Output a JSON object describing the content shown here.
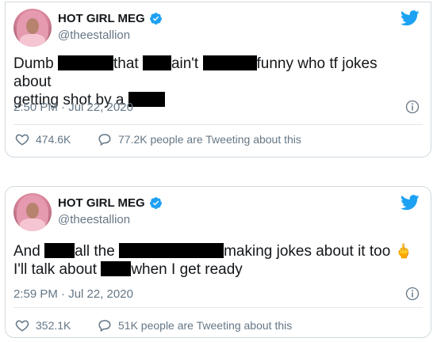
{
  "tweets": [
    {
      "name": "HOT GIRL MEG",
      "handle": "@theestallion",
      "text_parts": [
        "Dumb",
        "that",
        "ain't",
        "funny who tf jokes about",
        "getting shot by a"
      ],
      "time": "2:50 PM · Jul 22, 2020",
      "likes": "474.6K",
      "talking": "77.2K people are Tweeting about this"
    },
    {
      "name": "HOT GIRL MEG",
      "handle": "@theestallion",
      "text_parts": [
        "And",
        "all the",
        "making jokes about it too",
        "I'll talk about",
        "when I get ready"
      ],
      "emoji": "🖕",
      "time": "2:59 PM · Jul 22, 2020",
      "likes": "352.1K",
      "talking": "51K people are Tweeting about this"
    }
  ],
  "colors": {
    "twitter_blue": "#1da1f2",
    "text": "#14171a",
    "secondary": "#657786",
    "border": "#cfd9de",
    "redaction": "#000000"
  },
  "icons": {
    "verified": "verified-badge-icon",
    "bird": "twitter-bird-icon",
    "info": "info-circle-icon",
    "like": "heart-icon",
    "talking": "speech-bubble-icon"
  }
}
